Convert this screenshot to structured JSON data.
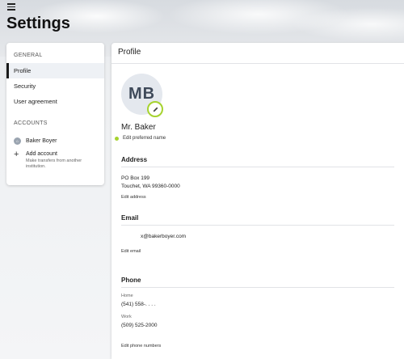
{
  "header": {
    "title": "Settings"
  },
  "nav": {
    "general_heading": "GENERAL",
    "items": [
      {
        "label": "Profile"
      },
      {
        "label": "Security"
      },
      {
        "label": "User agreement"
      }
    ],
    "accounts_heading": "ACCOUNTS",
    "account_name": "Baker Boyer",
    "add_account_label": "Add account",
    "add_account_desc": "Make transfers from another institution."
  },
  "profile": {
    "title": "Profile",
    "initials": "MB",
    "name": "Mr. Baker",
    "edit_preferred_name": "Edit preferred name",
    "address": {
      "heading": "Address",
      "line1": "PO Box 199",
      "line2": "Touchet, WA 99360-0000",
      "edit": "Edit address"
    },
    "email": {
      "heading": "Email",
      "value": "x@bakerboyer.com",
      "edit": "Edit email"
    },
    "phone": {
      "heading": "Phone",
      "home_label": "Home",
      "home_value": "(541) 558-. . . .",
      "work_label": "Work",
      "work_value": "(509) 525-2000",
      "edit": "Edit phone numbers"
    }
  },
  "colors": {
    "accent": "#a6d32f",
    "avatar_bg": "#e4e8ee"
  }
}
